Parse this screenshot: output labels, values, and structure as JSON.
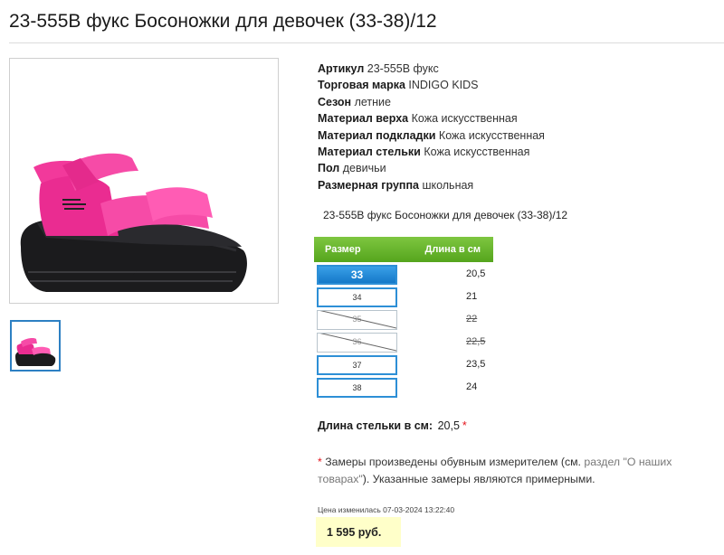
{
  "product": {
    "title": "23-555В фукс Босоножки для девочек (33-38)/12",
    "subtitle": "23-555В фукс Босоножки для девочек (33-38)/12"
  },
  "properties": [
    {
      "key": "Артикул",
      "value": "23-555В фукс"
    },
    {
      "key": "Торговая марка",
      "value": "INDIGO KIDS"
    },
    {
      "key": "Сезон",
      "value": "летние"
    },
    {
      "key": "Материал верха",
      "value": "Кожа искусственная"
    },
    {
      "key": "Материал подкладки",
      "value": "Кожа искусственная"
    },
    {
      "key": "Материал стельки",
      "value": "Кожа искусственная"
    },
    {
      "key": "Пол",
      "value": "девичьи"
    },
    {
      "key": "Размерная группа",
      "value": "школьная"
    }
  ],
  "size_table": {
    "header_size": "Размер",
    "header_length": "Длина в см",
    "rows": [
      {
        "size": "33",
        "length": "20,5",
        "state": "selected"
      },
      {
        "size": "34",
        "length": "21",
        "state": "available"
      },
      {
        "size": "35",
        "length": "22",
        "state": "unavailable"
      },
      {
        "size": "36",
        "length": "22,5",
        "state": "unavailable"
      },
      {
        "size": "37",
        "length": "23,5",
        "state": "available"
      },
      {
        "size": "38",
        "length": "24",
        "state": "available"
      }
    ]
  },
  "insole": {
    "label": "Длина стельки в см:",
    "value": "20,5",
    "asterisk": "*"
  },
  "note": {
    "asterisk": "*",
    "text_before": "Замеры произведены обувным измерителем (см.",
    "link": "раздел \"О наших товарах\"",
    "text_after": "). Указанные замеры являются примерными."
  },
  "price": {
    "changed_label": "Цена изменилась 07-03-2024 13:22:40",
    "value": "1 595 руб."
  },
  "colors": {
    "accent_blue": "#2d8fd6",
    "header_green": "#6ab52f",
    "price_bg": "#ffffc9",
    "sandal_pink": "#f2399b",
    "asterisk_red": "#e4131b"
  }
}
